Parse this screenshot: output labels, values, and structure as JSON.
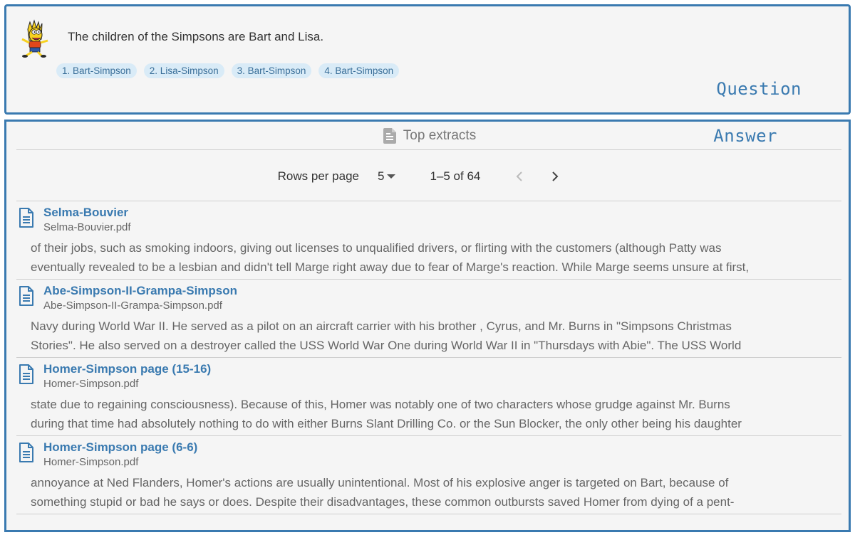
{
  "question": {
    "text": "The children of the Simpsons are Bart and Lisa.",
    "references": [
      "1. Bart-Simpson",
      "2. Lisa-Simpson",
      "3. Bart-Simpson",
      "4. Bart-Simpson"
    ],
    "label": "Question"
  },
  "answer": {
    "label": "Answer",
    "header_title": "Top extracts",
    "pagination": {
      "rows_label": "Rows per page",
      "rows_value": "5",
      "range": "1–5 of 64"
    },
    "results": [
      {
        "title": "Selma-Bouvier",
        "file": "Selma-Bouvier.pdf",
        "lines": [
          "of their jobs, such as smoking indoors, giving out licenses to unqualified drivers, or flirting with the customers (although Patty was",
          "eventually revealed to be a lesbian and didn't tell Marge right away due to fear of Marge's reaction. While Marge seems unsure at first,"
        ]
      },
      {
        "title": "Abe-Simpson-II-Grampa-Simpson",
        "file": "Abe-Simpson-II-Grampa-Simpson.pdf",
        "lines": [
          "Navy during World War II. He served as a pilot on an aircraft carrier with his brother , Cyrus, and Mr. Burns in \"Simpsons Christmas",
          "Stories\". He also served on a destroyer called the USS World War One during World War II in \"Thursdays with Abie\". The USS World"
        ]
      },
      {
        "title": "Homer-Simpson page (15-16)",
        "file": "Homer-Simpson.pdf",
        "lines": [
          "state due to regaining consciousness). Because of this, Homer was notably one of two characters whose grudge against Mr. Burns",
          "during that time had absolutely nothing to do with either Burns Slant Drilling Co. or the Sun Blocker, the only other being his daughter"
        ]
      },
      {
        "title": "Homer-Simpson page (6-6)",
        "file": "Homer-Simpson.pdf",
        "lines": [
          "annoyance at Ned Flanders, Homer's actions are usually unintentional. Most of his explosive anger is targeted on Bart, because of",
          "something stupid or bad he says or does. Despite their disadvantages, these common outbursts saved Homer from dying of a pent-"
        ]
      }
    ]
  },
  "colors": {
    "accent": "#3a7ab0",
    "chip_bg": "#d9ebf7",
    "panel_bg": "#f5f5f5"
  },
  "icons": {
    "avatar": "bart-avatar-icon",
    "header": "document-icon",
    "result": "file-document-icon",
    "prev": "chevron-left-icon",
    "next": "chevron-right-icon"
  }
}
